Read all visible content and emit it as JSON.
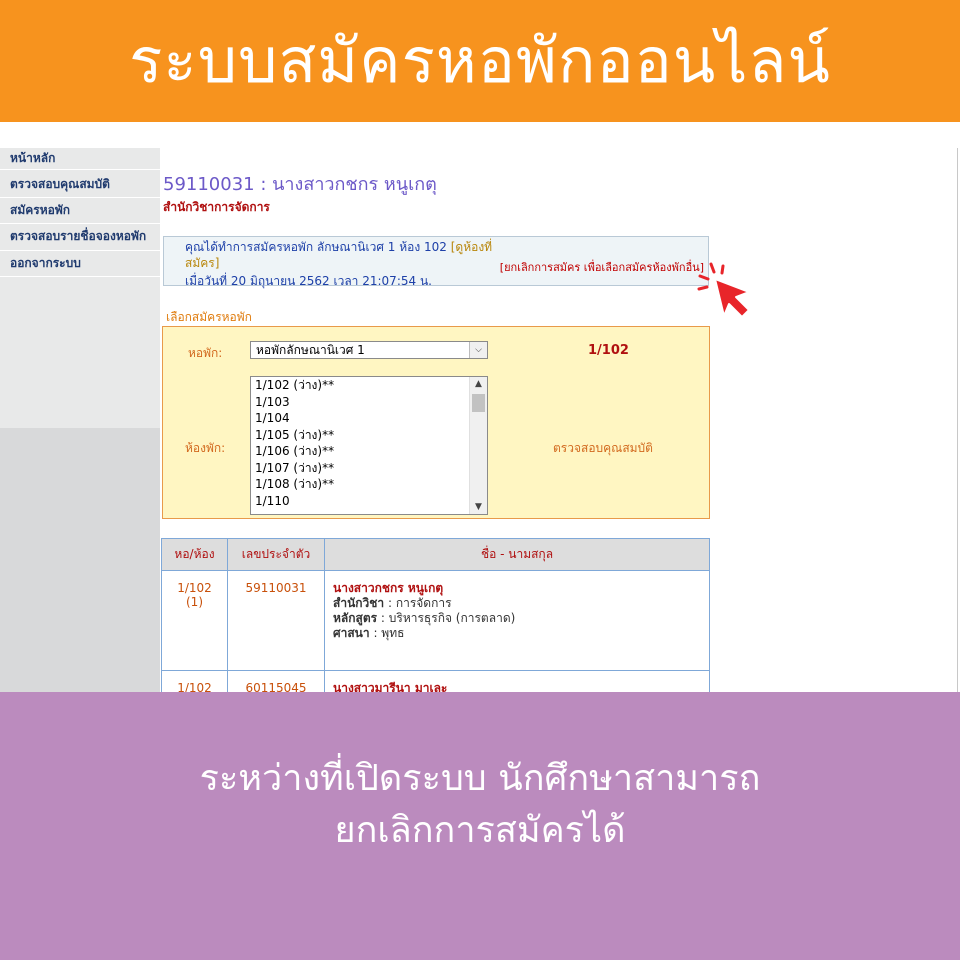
{
  "banner": {
    "title": "ระบบสมัครหอพักออนไลน์"
  },
  "sidebar": {
    "items": [
      {
        "label": "หน้าหลัก"
      },
      {
        "label": "ตรวจสอบคุณสมบัติ"
      },
      {
        "label": "สมัครหอพัก"
      },
      {
        "label": "ตรวจสอบรายชื่อจองหอพัก"
      },
      {
        "label": "ออกจากระบบ"
      }
    ]
  },
  "student": {
    "heading": "59110031 : นางสาวกชกร หนูเกตุ",
    "faculty": "สำนักวิชาการจัดการ"
  },
  "notice": {
    "text": "คุณได้ทำการสมัครหอพัก ลักษณานิเวศ 1 ห้อง 102 ",
    "link": "[ดูห้องที่สมัคร]",
    "date": "เมื่อวันที่ 20 มิถุนายน 2562  เวลา  21:07:54 น.",
    "cancel": "[ยกเลิกการสมัคร เพื่อเลือกสมัครห้องพักอื่น]"
  },
  "selection": {
    "section_label": "เลือกสมัครหอพัก",
    "dorm_label": "หอพัก:",
    "dorm_value": "หอพักลักษณานิเวศ 1",
    "room_code": "1/102",
    "room_label": "ห้องพัก:",
    "rooms": [
      "1/102 (ว่าง)**",
      "1/103",
      "1/104",
      "1/105 (ว่าง)**",
      "1/106 (ว่าง)**",
      "1/107 (ว่าง)**",
      "1/108 (ว่าง)**",
      "1/110"
    ],
    "check_link": "ตรวจสอบคุณสมบัติ"
  },
  "table": {
    "headers": [
      "หอ/ห้อง",
      "เลขประจำตัว",
      "ชื่อ - นามสกุล"
    ],
    "rows": [
      {
        "room": "1/102",
        "slot": "(1)",
        "id": "59110031",
        "name": "นางสาวกชกร หนูเกตุ",
        "faculty_label": "สำนักวิชา",
        "faculty_value": " : การจัดการ",
        "program_label": "หลักสูตร",
        "program_value": " : บริหารธุรกิจ (การตลาด)",
        "religion_label": "ศาสนา",
        "religion_value": " : พุทธ"
      },
      {
        "room": "1/102",
        "id": "60115045",
        "name": "นางสาวมารีนา มาเละ"
      }
    ]
  },
  "caption": {
    "line1": "ระหว่างที่เปิดระบบ นักศึกษาสามารถ",
    "line2": "ยกเลิกการสมัครได้"
  },
  "colors": {
    "top_banner": "#f7931e",
    "bottom_banner": "#bb8bbe",
    "pointer": "#e8252a"
  },
  "icons": {
    "cursor": "arrow-cursor-icon",
    "pointer": "hand-pointer-icon"
  }
}
